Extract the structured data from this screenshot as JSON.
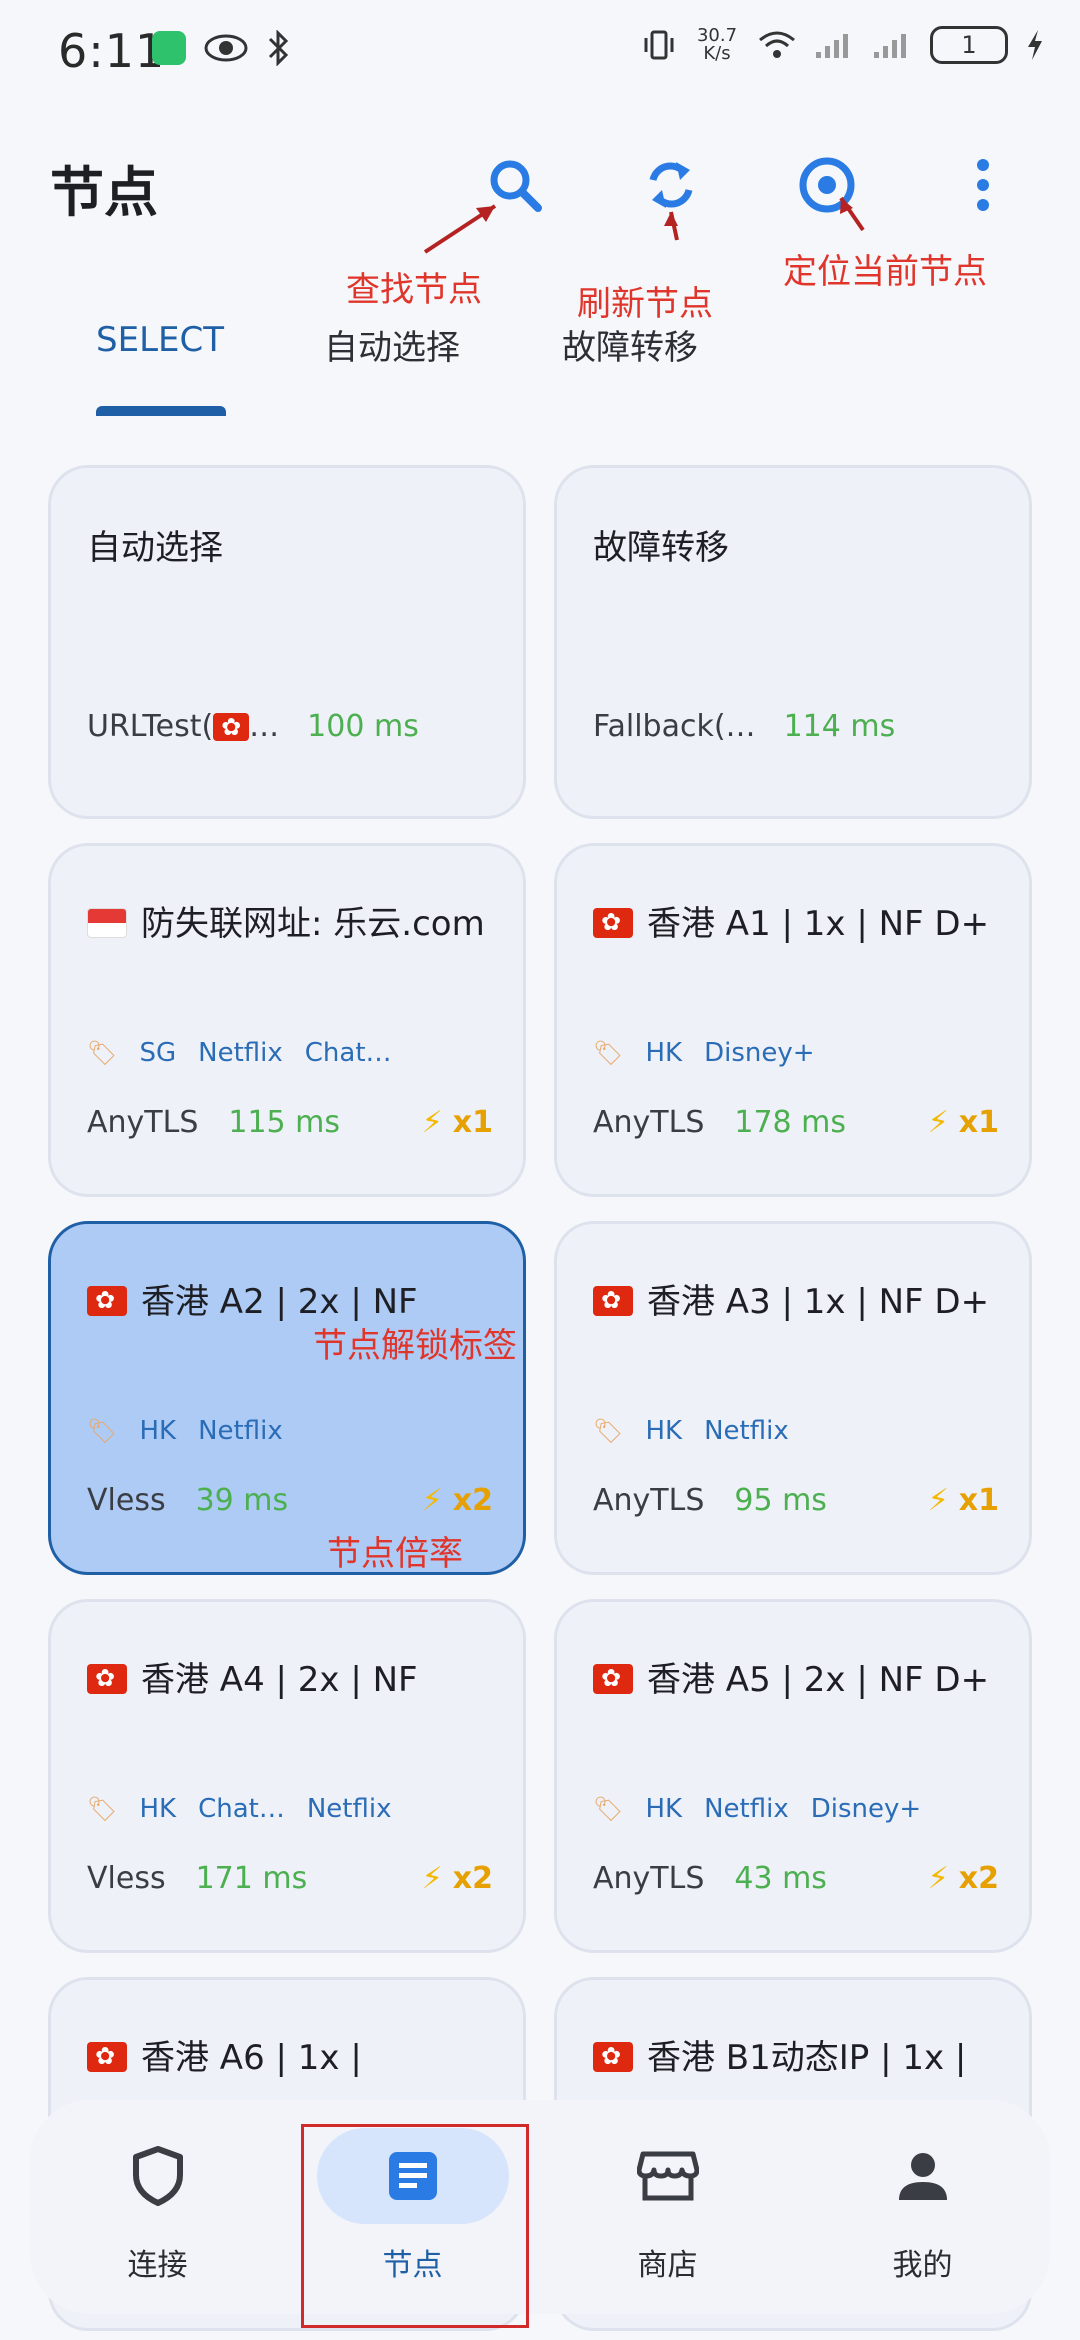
{
  "status_bar": {
    "time": "6:11",
    "speed_value": "30.7",
    "speed_unit": "K/s",
    "battery_level": "1"
  },
  "header": {
    "title": "节点",
    "icons": [
      "search-icon",
      "refresh-icon",
      "locate-icon",
      "more-vert-icon"
    ]
  },
  "annotations": {
    "search": "查找节点",
    "refresh": "刷新节点",
    "locate": "定位当前节点",
    "unlock_tags": "节点解锁标签",
    "multiplier": "节点倍率"
  },
  "tabs": [
    {
      "label": "SELECT",
      "active": true
    },
    {
      "label": "自动选择",
      "active": false
    },
    {
      "label": "故障转移",
      "active": false
    }
  ],
  "cards": [
    {
      "title": "自动选择",
      "proto": "URLTest(",
      "ellipsis": "…",
      "latency": "100 ms"
    },
    {
      "title": "故障转移",
      "proto": "Fallback(…",
      "latency": "114 ms"
    },
    {
      "title": "防失联网址: 乐云.com",
      "flag": "sg",
      "tags": [
        "SG",
        "Netflix",
        "Chat…"
      ],
      "proto": "AnyTLS",
      "latency": "115 ms",
      "multiplier": "x1"
    },
    {
      "title": "香港 A1 | 1x | NF D+",
      "flag": "hk",
      "tags": [
        "HK",
        "Disney+"
      ],
      "proto": "AnyTLS",
      "latency": "178 ms",
      "multiplier": "x1"
    },
    {
      "title": "香港 A2 | 2x | NF",
      "flag": "hk",
      "tags": [
        "HK",
        "Netflix"
      ],
      "proto": "Vless",
      "latency": "39 ms",
      "multiplier": "x2",
      "selected": true
    },
    {
      "title": "香港 A3 | 1x  | NF D+",
      "flag": "hk",
      "tags": [
        "HK",
        "Netflix"
      ],
      "proto": "AnyTLS",
      "latency": "95 ms",
      "multiplier": "x1"
    },
    {
      "title": "香港 A4 | 2x | NF",
      "flag": "hk",
      "tags": [
        "HK",
        "Chat…",
        "Netflix"
      ],
      "proto": "Vless",
      "latency": "171 ms",
      "multiplier": "x2"
    },
    {
      "title": "香港 A5 | 2x | NF D+",
      "flag": "hk",
      "tags": [
        "HK",
        "Netflix",
        "Disney+"
      ],
      "proto": "AnyTLS",
      "latency": "43 ms",
      "multiplier": "x2"
    },
    {
      "title": "香港 A6 | 1x |",
      "flag": "hk"
    },
    {
      "title": "香港 B1动态IP | 1x |",
      "flag": "hk"
    }
  ],
  "bottom_nav": [
    {
      "label": "连接",
      "icon": "shield-icon"
    },
    {
      "label": "节点",
      "icon": "list-icon",
      "active": true
    },
    {
      "label": "商店",
      "icon": "store-icon"
    },
    {
      "label": "我的",
      "icon": "person-icon"
    }
  ],
  "colors": {
    "accent": "#1f5fa6",
    "latency_green": "#4caf50",
    "multiplier_amber": "#e6a000",
    "annotation_red": "#e0352b",
    "selected_card": "#aecbf6"
  }
}
